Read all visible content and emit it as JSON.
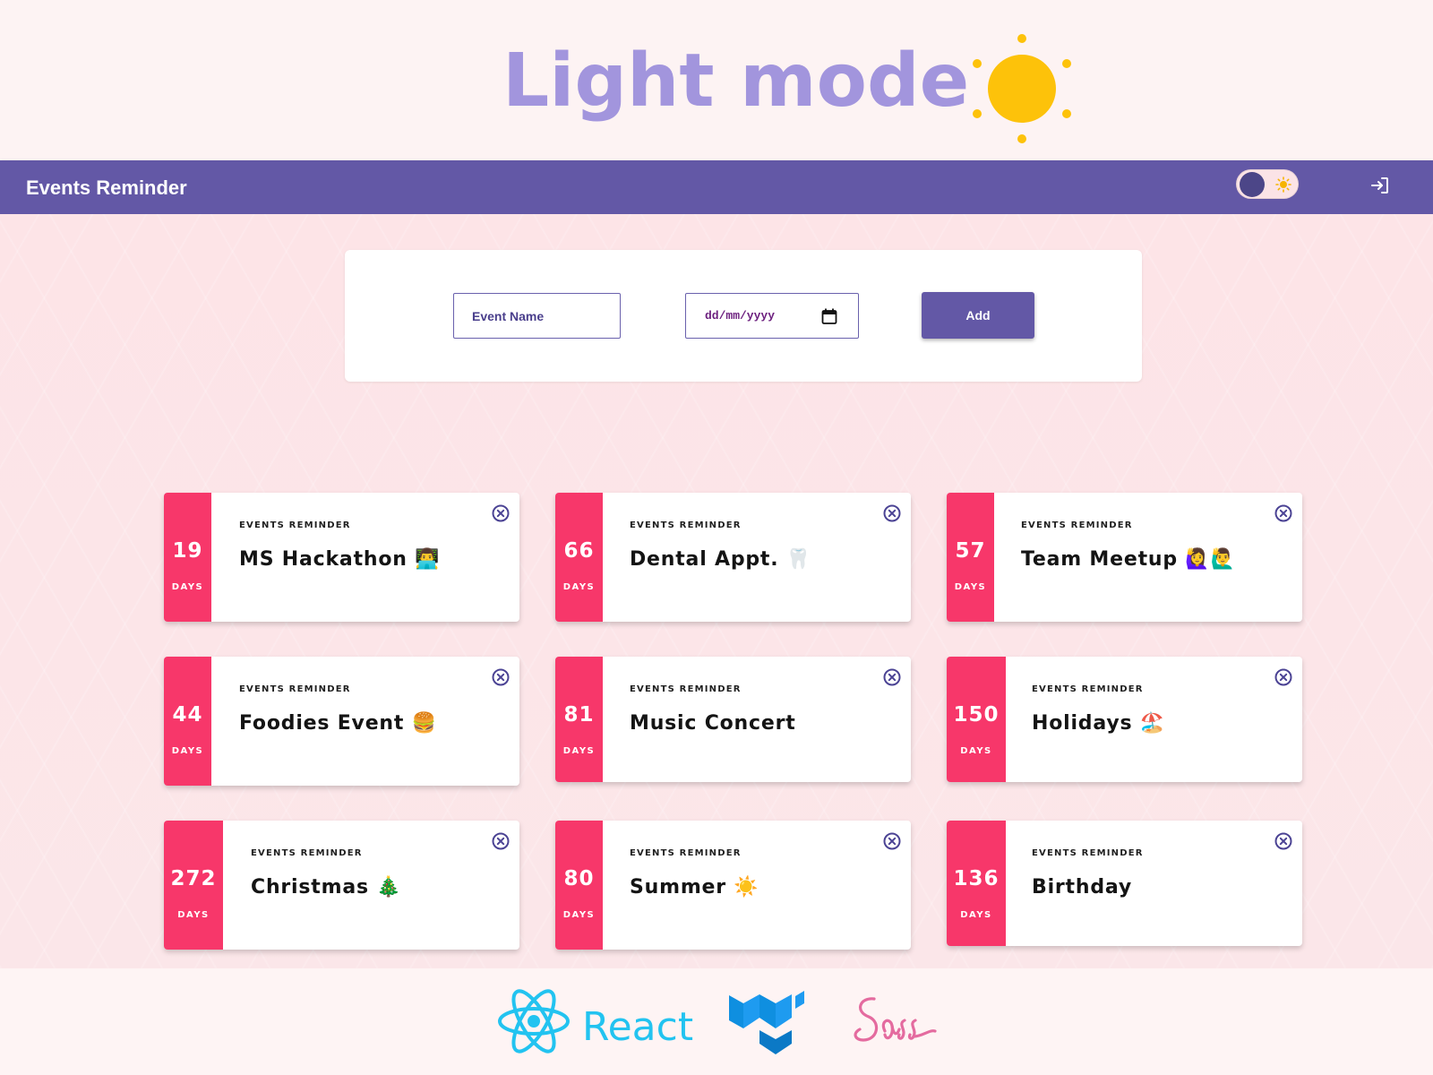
{
  "hero": {
    "title": "Light mode",
    "icon": "sun-icon",
    "sun_color": "#fdc20a"
  },
  "appbar": {
    "title": "Events Reminder",
    "toggle": {
      "state": "light",
      "icon": "sun-icon"
    },
    "logout_icon": "logout-icon",
    "color": "#6358a6"
  },
  "form": {
    "event_name_placeholder": "Event Name",
    "date_placeholder": "dd/mm/yyyy",
    "add_label": "Add"
  },
  "events": [
    {
      "days": "19",
      "days_label": "DAYS",
      "eyebrow": "EVENTS REMINDER",
      "title": "MS Hackathon 👨‍💻"
    },
    {
      "days": "66",
      "days_label": "DAYS",
      "eyebrow": "EVENTS REMINDER",
      "title": "Dental Appt. 🦷"
    },
    {
      "days": "57",
      "days_label": "DAYS",
      "eyebrow": "EVENTS REMINDER",
      "title": "Team Meetup 🙋‍♀️🙋‍♂️"
    },
    {
      "days": "44",
      "days_label": "DAYS",
      "eyebrow": "EVENTS REMINDER",
      "title": "Foodies Event 🍔"
    },
    {
      "days": "81",
      "days_label": "DAYS",
      "eyebrow": "EVENTS REMINDER",
      "title": "Music Concert"
    },
    {
      "days": "150",
      "days_label": "DAYS",
      "eyebrow": "EVENTS REMINDER",
      "title": "Holidays 🏖️"
    },
    {
      "days": "272",
      "days_label": "DAYS",
      "eyebrow": "EVENTS REMINDER",
      "title": "Christmas 🎄"
    },
    {
      "days": "80",
      "days_label": "DAYS",
      "eyebrow": "EVENTS REMINDER",
      "title": "Summer ☀️"
    },
    {
      "days": "136",
      "days_label": "DAYS",
      "eyebrow": "EVENTS REMINDER",
      "title": "Birthday"
    }
  ],
  "colors": {
    "accent": "#f7376a",
    "primary": "#6358a6",
    "hero_text": "#a295dd"
  },
  "footer": {
    "react_label": "React",
    "logos": [
      "react-logo",
      "mui-logo",
      "sass-logo"
    ]
  }
}
